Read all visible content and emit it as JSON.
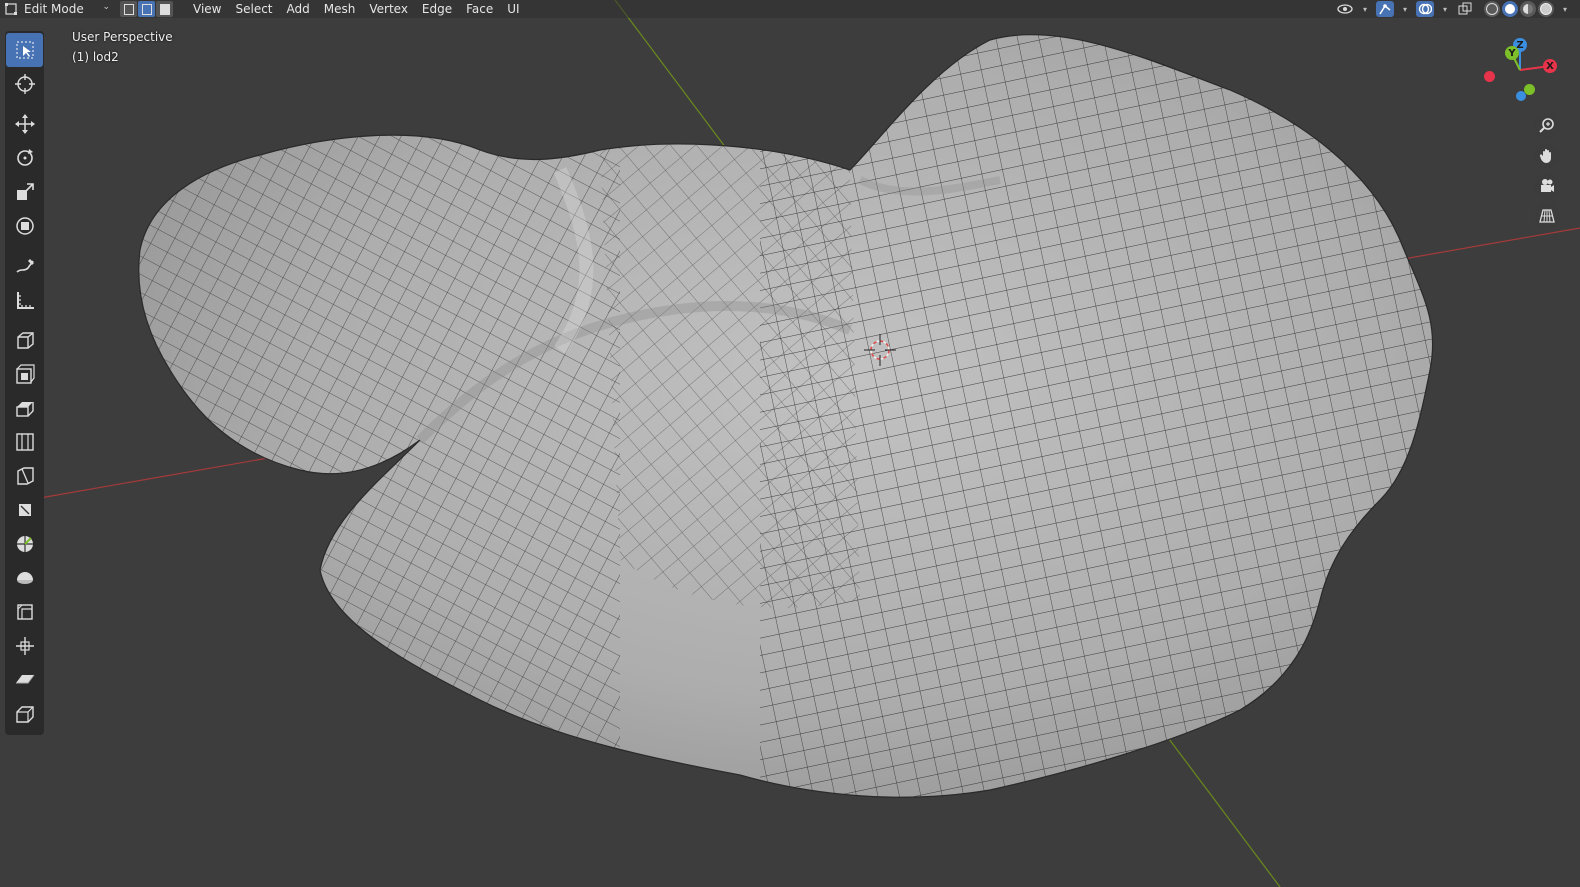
{
  "header": {
    "mode_label": "Edit Mode",
    "mode_icon": "edit-mode-icon",
    "select_modes": [
      "vertex-select-icon",
      "edge-select-icon",
      "face-select-icon"
    ],
    "active_select_mode": "edge",
    "menus": [
      "View",
      "Select",
      "Add",
      "Mesh",
      "Vertex",
      "Edge",
      "Face",
      "UI"
    ],
    "right_icons": [
      "visibility-icon",
      "gizmo-icon",
      "overlay-icon",
      "xray-icon",
      "wireframe-shading-icon",
      "solid-shading-icon",
      "material-shading-icon",
      "rendered-shading-icon"
    ],
    "active_shading": "solid"
  },
  "viewport": {
    "view_name": "User Perspective",
    "object_name": "(1) lod2"
  },
  "toolbar": {
    "tools": [
      "select-box",
      "cursor",
      "move",
      "rotate",
      "scale",
      "transform",
      "annotate",
      "measure",
      "add-cube",
      "extrude-region",
      "inset-faces",
      "bevel",
      "loop-cut",
      "knife",
      "poly-build",
      "spin",
      "smooth",
      "edge-slide",
      "shrink-fatten",
      "shear",
      "rip-region"
    ],
    "active_tool": "select-box"
  },
  "navigation": {
    "gizmo_axes": [
      "X",
      "Y",
      "Z"
    ],
    "buttons": [
      "zoom-icon",
      "pan-hand-icon",
      "camera-icon",
      "perspective-grid-icon"
    ]
  },
  "colors": {
    "background": "#3d3d3d",
    "accent": "#4772b3",
    "mesh_fill": "#b3b3b3",
    "x_axis": "#a63a3a",
    "y_axis": "#6b8a1e",
    "x_gizmo": "#e8344b",
    "y_gizmo": "#7cbf28",
    "z_gizmo": "#3b8fe0"
  }
}
